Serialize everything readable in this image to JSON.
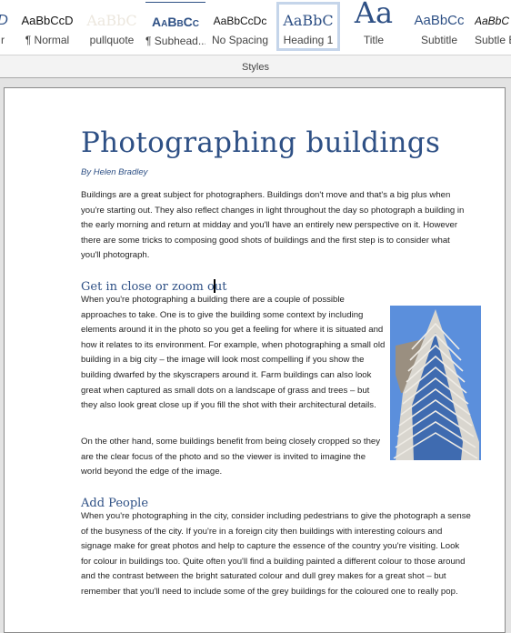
{
  "ribbon": {
    "group_label": "Styles",
    "styles": [
      {
        "preview": "D",
        "label": "r",
        "color": "#2e5085",
        "italic": true
      },
      {
        "preview": "AaBbCcD",
        "label": "¶ Normal",
        "color": "#111111"
      },
      {
        "preview": "AaBbC",
        "label": "pullquote",
        "color": "#ece7de"
      },
      {
        "preview": "AaBbCc",
        "label": "¶ Subhead...",
        "color": "#2e5085"
      },
      {
        "preview": "AaBbCcDc",
        "label": "No Spacing",
        "color": "#111111"
      },
      {
        "preview": "AaBbC",
        "label": "Heading 1",
        "color": "#2e5085",
        "selected": true
      },
      {
        "preview": "Aa",
        "label": "Title",
        "color": "#2e5085"
      },
      {
        "preview": "AaBbCc",
        "label": "Subtitle",
        "color": "#2e5085"
      },
      {
        "preview": "AaBbC",
        "label": "Subtle E",
        "color": "#111111",
        "italic": true
      }
    ]
  },
  "document": {
    "title": "Photographing buildings",
    "byline": "By Helen Bradley",
    "intro": "Buildings are a great subject for photographers. Buildings don't move and that's a big plus when you're starting out. They also reflect changes in light throughout the day so photograph a building in the early morning and return at midday and you'll have an entirely new perspective on it. However there are some tricks to composing good shots of buildings and the first step is to consider what you'll photograph.",
    "section1": {
      "heading_before_cursor": "Get in close or zoom o",
      "heading_after_cursor": "ut",
      "para1": "When you're photographing a building there are a couple of possible approaches to take. One is to give the building some context by including elements around it in the photo so you get a feeling for where it is situated and how it relates to its environment. For example, when photographing a small old building in a big city – the image will look most compelling if you show the building dwarfed by the skyscrapers around it. Farm buildings can also look great when captured as small dots on a landscape of grass and trees – but they also look great close up if you fill the shot with their architectural details.",
      "para2": "On the other hand, some buildings benefit from being closely cropped so they are the clear focus of the photo and so the viewer is invited to imagine the world beyond the edge of the image."
    },
    "section2": {
      "heading": "Add People",
      "para1": "When you're photographing in the city, consider including pedestrians to give the photograph a sense of the busyness of the city. If you're in a foreign city then buildings with interesting colours and signage make for great photos and help to capture the essence of the country you're visiting. Look for colour in buildings too. Quite often you'll find a building painted a different colour to those around and the contrast between the bright saturated colour and dull grey makes for a great shot – but remember that you'll need to include some of the grey buildings for the coloured one to really pop."
    },
    "image": {
      "alt": "Skyscraper with striped facade against blue sky",
      "sky_color": "#5b8fdc"
    }
  }
}
